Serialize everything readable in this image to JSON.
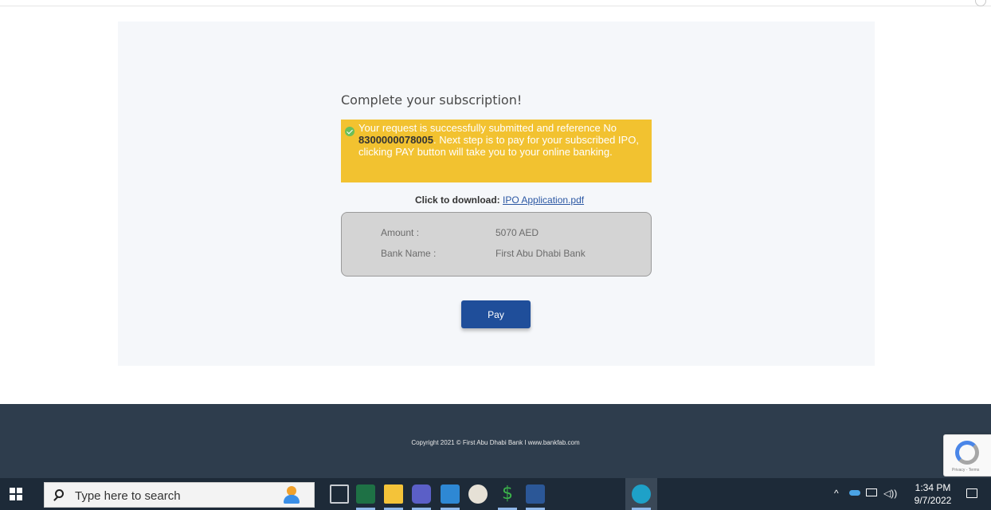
{
  "subscription": {
    "heading": "Complete your subscription!",
    "alert_text_before": "Your request is successfully submitted and reference No ",
    "reference_no": "8300000078005",
    "alert_text_after": ". Next step is to pay for your subscribed IPO, clicking PAY button will take you to your online banking.",
    "download_label": "Click to download:",
    "download_link": "IPO Application.pdf",
    "amount_label": "Amount :",
    "amount_value": "5070 AED",
    "bank_label": "Bank Name :",
    "bank_value": "First Abu Dhabi Bank",
    "pay_label": "Pay"
  },
  "footer": {
    "copyright": "Copyright 2021 © First Abu Dhabi Bank I www.bankfab.com"
  },
  "recaptcha": {
    "text": "Privacy - Terms"
  },
  "taskbar": {
    "search_placeholder": "Type here to search",
    "time": "1:34 PM",
    "date": "9/7/2022",
    "apps": [
      "task-view",
      "excel",
      "file-explorer",
      "teams",
      "outlook",
      "paint",
      "s-app",
      "word",
      "edge"
    ]
  },
  "colors": {
    "alert_bg": "#f2c230",
    "pay_button": "#1f4e9a",
    "footer_bg": "#2e3d4d",
    "taskbar_bg": "#1d2a38"
  }
}
